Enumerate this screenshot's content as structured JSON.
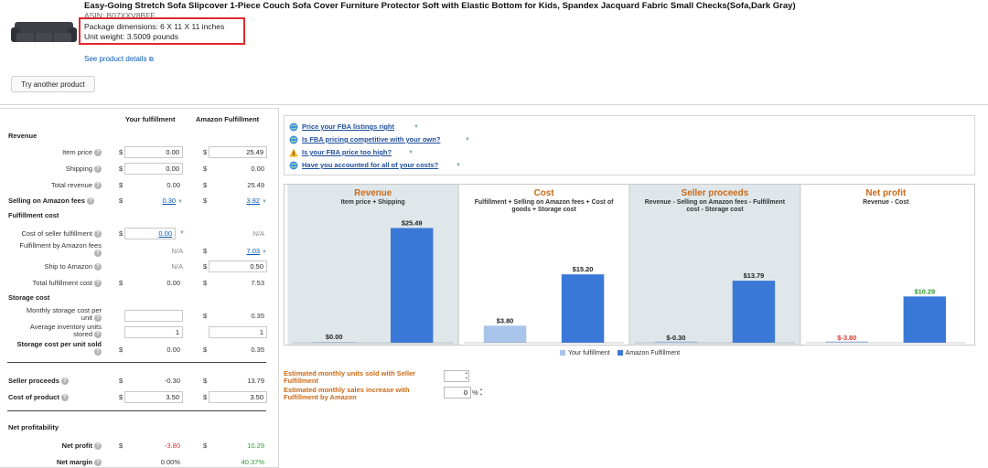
{
  "header": {
    "product_title": "Easy-Going Stretch Sofa Slipcover 1-Piece Couch Sofa Cover Furniture Protector Soft with Elastic Bottom for Kids, Spandex Jacquard Fabric Small Checks(Sofa,Dark Gray)",
    "asin": "ASIN: B07XXV8BFF",
    "package_dimensions": "Package dimensions: 6 X 11 X 11 inches",
    "unit_weight": "Unit weight: 3.5009 pounds",
    "see_details": "See product details",
    "try_another": "Try another product"
  },
  "calc": {
    "col_your": "Your fulfillment",
    "col_amazon": "Amazon Fulfillment",
    "currency": "$",
    "revenue_section": "Revenue",
    "item_price": {
      "label": "Item price",
      "your": "0.00",
      "amazon": "25.49"
    },
    "shipping": {
      "label": "Shipping",
      "your": "0.00",
      "amazon": "0.00"
    },
    "total_revenue": {
      "label": "Total revenue",
      "your": "0.00",
      "amazon": "25.49"
    },
    "selling_fees": {
      "label": "Selling on Amazon fees",
      "your": "0.30",
      "amazon": "3.82"
    },
    "fulfillment_section": "Fulfillment cost",
    "seller_fulfillment_cost": {
      "label": "Cost of seller fulfillment",
      "your": "0.00",
      "amazon": "N/A"
    },
    "fba_fees": {
      "label": "Fulfillment by Amazon fees",
      "your": "N/A",
      "amazon": "7.03"
    },
    "ship_to_amazon": {
      "label": "Ship to Amazon",
      "your": "N/A",
      "amazon": "0.50"
    },
    "total_fulfillment": {
      "label": "Total fulfillment cost",
      "your": "0.00",
      "amazon": "7.53"
    },
    "storage_section": "Storage cost",
    "monthly_storage": {
      "label": "Monthly storage cost per unit",
      "your": "",
      "amazon": "0.35"
    },
    "avg_inventory": {
      "label": "Average inventory units stored",
      "your": "1",
      "amazon": "1"
    },
    "storage_per_unit": {
      "label": "Storage cost per unit sold",
      "your": "0.00",
      "amazon": "0.35"
    },
    "seller_proceeds": {
      "label": "Seller proceeds",
      "your": "-0.30",
      "amazon": "13.79"
    },
    "cost_of_product": {
      "label": "Cost of product",
      "your": "3.50",
      "amazon": "3.50"
    },
    "net_section": "Net profitability",
    "net_profit": {
      "label": "Net profit",
      "your": "-3.80",
      "amazon": "10.29"
    },
    "net_margin": {
      "label": "Net margin",
      "your": "0.00%",
      "amazon": "40.37%"
    }
  },
  "tips": [
    {
      "text": "Price your FBA listings right",
      "icon": "globe-icon"
    },
    {
      "text": "Is FBA pricing competitive with your own?",
      "icon": "globe-icon"
    },
    {
      "text": "Is your FBA price too high?",
      "icon": "warning-icon"
    },
    {
      "text": "Have you accounted for all of your costs?",
      "icon": "globe-icon"
    }
  ],
  "chart_data": {
    "type": "bar",
    "panels": [
      {
        "title": "Revenue",
        "subtitle": "Item price + Shipping",
        "your": 0.0,
        "amazon": 25.49,
        "your_label": "$0.00",
        "amazon_label": "$25.49"
      },
      {
        "title": "Cost",
        "subtitle": "Fulfillment + Selling on Amazon fees + Cost of goods + Storage cost",
        "your": 3.8,
        "amazon": 15.2,
        "your_label": "$3.80",
        "amazon_label": "$15.20"
      },
      {
        "title": "Seller proceeds",
        "subtitle": "Revenue - Selling on Amazon fees - Fulfillment cost - Storage cost",
        "your": -0.3,
        "amazon": 13.79,
        "your_label": "$-0.30",
        "amazon_label": "$13.79"
      },
      {
        "title": "Net profit",
        "subtitle": "Revenue - Cost",
        "your": -3.8,
        "amazon": 10.29,
        "your_label": "$-3.80",
        "amazon_label": "$10.29"
      }
    ],
    "series": [
      {
        "name": "Your fulfillment",
        "color": "#a9c4ea"
      },
      {
        "name": "Amazon Fulfillment",
        "color": "#3a78d8"
      }
    ],
    "ylim": [
      0,
      25.49
    ],
    "colors": {
      "title": "#c96a17",
      "negative": "#d9322a",
      "positive": "#2e9a2e",
      "label": "#222222",
      "panel_bg_a": "#dfe7ea",
      "panel_bg_b": "#ffffff"
    }
  },
  "estimates": {
    "monthly_units_label": "Estimated monthly units sold with Seller Fulfillment",
    "monthly_units_value": "",
    "sales_increase_label": "Estimated monthly sales increase with Fulfillment by Amazon",
    "sales_increase_value": "0",
    "pct": "%"
  }
}
